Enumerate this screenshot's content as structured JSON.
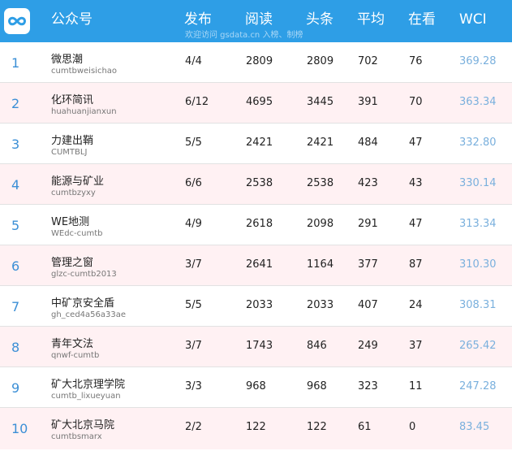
{
  "header": {
    "columns": {
      "name": "公众号",
      "publish": "发布",
      "read": "阅读",
      "headline": "头条",
      "average": "平均",
      "watching": "在看",
      "wci": "WCI"
    },
    "watermark": "欢迎访问 gsdata.cn 入榜、制榜"
  },
  "colors": {
    "header_bg": "#2e9ee6",
    "alt_row_bg": "#fff1f3",
    "rank_blue": "#3b8fd6",
    "wci_blue": "#7ab0dd"
  },
  "icons": {
    "logo": "infinity-logo-icon"
  },
  "rows": [
    {
      "rank": "1",
      "name": "微思潮",
      "account": "cumtbweisichao",
      "publish": "4/4",
      "read": "2809",
      "headline": "2809",
      "average": "702",
      "watching": "76",
      "wci": "369.28"
    },
    {
      "rank": "2",
      "name": "化环简讯",
      "account": "huahuanjianxun",
      "publish": "6/12",
      "read": "4695",
      "headline": "3445",
      "average": "391",
      "watching": "70",
      "wci": "363.34"
    },
    {
      "rank": "3",
      "name": "力建出鞘",
      "account": "CUMTBLJ",
      "publish": "5/5",
      "read": "2421",
      "headline": "2421",
      "average": "484",
      "watching": "47",
      "wci": "332.80"
    },
    {
      "rank": "4",
      "name": "能源与矿业",
      "account": "cumtbzyxy",
      "publish": "6/6",
      "read": "2538",
      "headline": "2538",
      "average": "423",
      "watching": "43",
      "wci": "330.14"
    },
    {
      "rank": "5",
      "name": "WE地测",
      "account": "WEdc-cumtb",
      "publish": "4/9",
      "read": "2618",
      "headline": "2098",
      "average": "291",
      "watching": "47",
      "wci": "313.34"
    },
    {
      "rank": "6",
      "name": "管理之窗",
      "account": "glzc-cumtb2013",
      "publish": "3/7",
      "read": "2641",
      "headline": "1164",
      "average": "377",
      "watching": "87",
      "wci": "310.30"
    },
    {
      "rank": "7",
      "name": "中矿京安全盾",
      "account": "gh_ced4a56a33ae",
      "publish": "5/5",
      "read": "2033",
      "headline": "2033",
      "average": "407",
      "watching": "24",
      "wci": "308.31"
    },
    {
      "rank": "8",
      "name": "青年文法",
      "account": "qnwf-cumtb",
      "publish": "3/7",
      "read": "1743",
      "headline": "846",
      "average": "249",
      "watching": "37",
      "wci": "265.42"
    },
    {
      "rank": "9",
      "name": "矿大北京理学院",
      "account": "cumtb_lixueyuan",
      "publish": "3/3",
      "read": "968",
      "headline": "968",
      "average": "323",
      "watching": "11",
      "wci": "247.28"
    },
    {
      "rank": "10",
      "name": "矿大北京马院",
      "account": "cumtbsmarx",
      "publish": "2/2",
      "read": "122",
      "headline": "122",
      "average": "61",
      "watching": "0",
      "wci": "83.45"
    }
  ]
}
